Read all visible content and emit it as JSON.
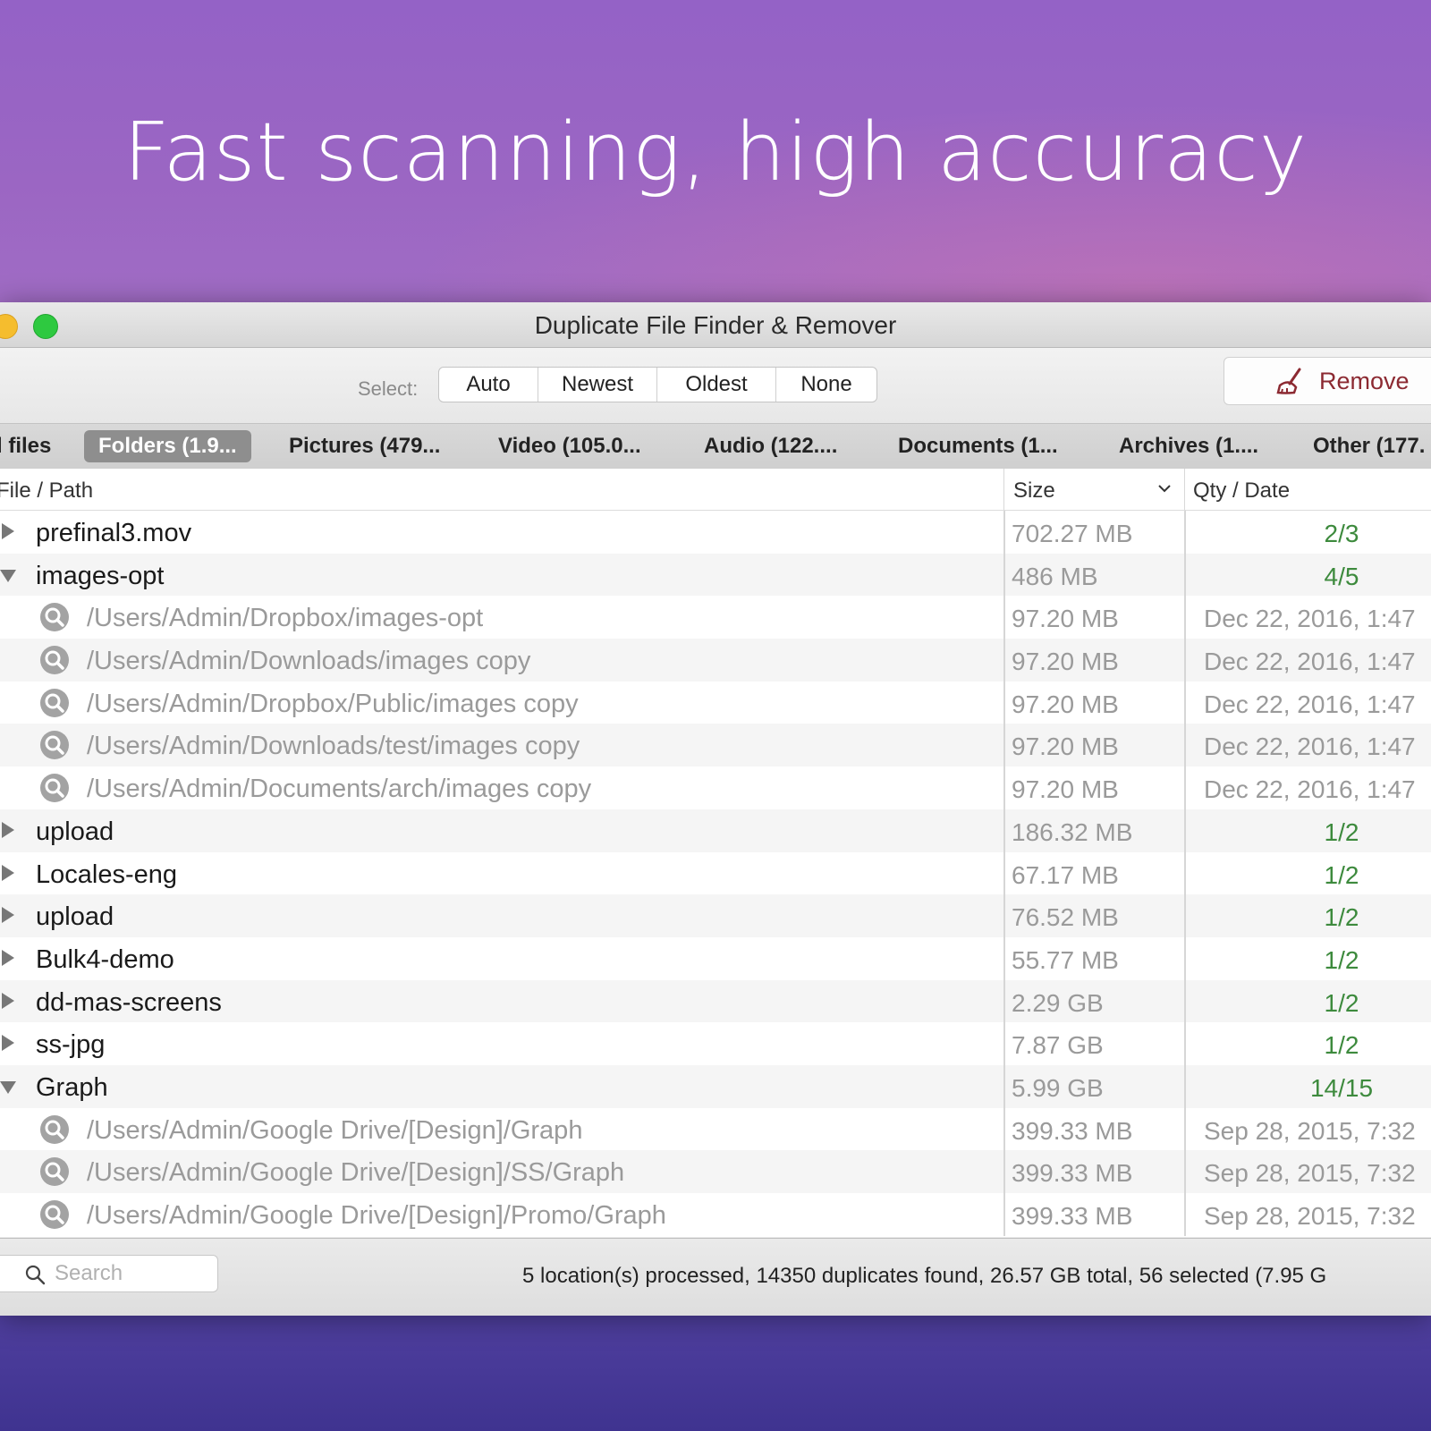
{
  "headline": "Fast scanning, high accuracy",
  "window": {
    "title": "Duplicate File Finder & Remover"
  },
  "toolbar": {
    "select_label": "Select:",
    "select_options": [
      "Auto",
      "Newest",
      "Oldest",
      "None"
    ],
    "remove_label": "Remove"
  },
  "tabs": [
    {
      "label": "l files",
      "active": false
    },
    {
      "label": "Folders (1.9...",
      "active": true
    },
    {
      "label": "Pictures (479...",
      "active": false
    },
    {
      "label": "Video (105.0...",
      "active": false
    },
    {
      "label": "Audio (122....",
      "active": false
    },
    {
      "label": "Documents (1...",
      "active": false
    },
    {
      "label": "Archives (1....",
      "active": false
    },
    {
      "label": "Other (177.",
      "active": false
    }
  ],
  "columns": {
    "path": "File / Path",
    "size": "Size",
    "qty_date": "Qty / Date"
  },
  "rows": [
    {
      "kind": "group",
      "expanded": false,
      "name": "prefinal3.mov",
      "size": "702.27 MB",
      "qty": "2/3"
    },
    {
      "kind": "group",
      "expanded": true,
      "name": "images-opt",
      "size": "486 MB",
      "qty": "4/5"
    },
    {
      "kind": "item",
      "path": "/Users/Admin/Dropbox/images-opt",
      "size": "97.20 MB",
      "date": "Dec 22, 2016, 1:47"
    },
    {
      "kind": "item",
      "path": "/Users/Admin/Downloads/images copy",
      "size": "97.20 MB",
      "date": "Dec 22, 2016, 1:47"
    },
    {
      "kind": "item",
      "path": "/Users/Admin/Dropbox/Public/images copy",
      "size": "97.20 MB",
      "date": "Dec 22, 2016, 1:47"
    },
    {
      "kind": "item",
      "path": "/Users/Admin/Downloads/test/images copy",
      "size": "97.20 MB",
      "date": "Dec 22, 2016, 1:47"
    },
    {
      "kind": "item",
      "path": "/Users/Admin/Documents/arch/images copy",
      "size": "97.20 MB",
      "date": "Dec 22, 2016, 1:47"
    },
    {
      "kind": "group",
      "expanded": false,
      "name": "upload",
      "size": "186.32 MB",
      "qty": "1/2"
    },
    {
      "kind": "group",
      "expanded": false,
      "name": "Locales-eng",
      "size": "67.17 MB",
      "qty": "1/2"
    },
    {
      "kind": "group",
      "expanded": false,
      "name": "upload",
      "size": "76.52 MB",
      "qty": "1/2"
    },
    {
      "kind": "group",
      "expanded": false,
      "name": "Bulk4-demo",
      "size": "55.77 MB",
      "qty": "1/2"
    },
    {
      "kind": "group",
      "expanded": false,
      "name": "dd-mas-screens",
      "size": "2.29 GB",
      "qty": "1/2"
    },
    {
      "kind": "group",
      "expanded": false,
      "name": "ss-jpg",
      "size": "7.87 GB",
      "qty": "1/2"
    },
    {
      "kind": "group",
      "expanded": true,
      "name": "Graph",
      "size": "5.99 GB",
      "qty": "14/15"
    },
    {
      "kind": "item",
      "path": "/Users/Admin/Google Drive/[Design]/Graph",
      "size": "399.33 MB",
      "date": "Sep 28, 2015, 7:32"
    },
    {
      "kind": "item",
      "path": "/Users/Admin/Google Drive/[Design]/SS/Graph",
      "size": "399.33 MB",
      "date": "Sep 28, 2015, 7:32"
    },
    {
      "kind": "item",
      "path": "/Users/Admin/Google Drive/[Design]/Promo/Graph",
      "size": "399.33 MB",
      "date": "Sep 28, 2015, 7:32"
    }
  ],
  "footer": {
    "search_placeholder": "Search",
    "status": "5 location(s) processed, 14350 duplicates found, 26.57 GB total, 56 selected (7.95 G"
  },
  "colors": {
    "qty_green": "#3d8a3d",
    "remove_red": "#8c2a32",
    "active_tab": "#8e8e8e"
  }
}
